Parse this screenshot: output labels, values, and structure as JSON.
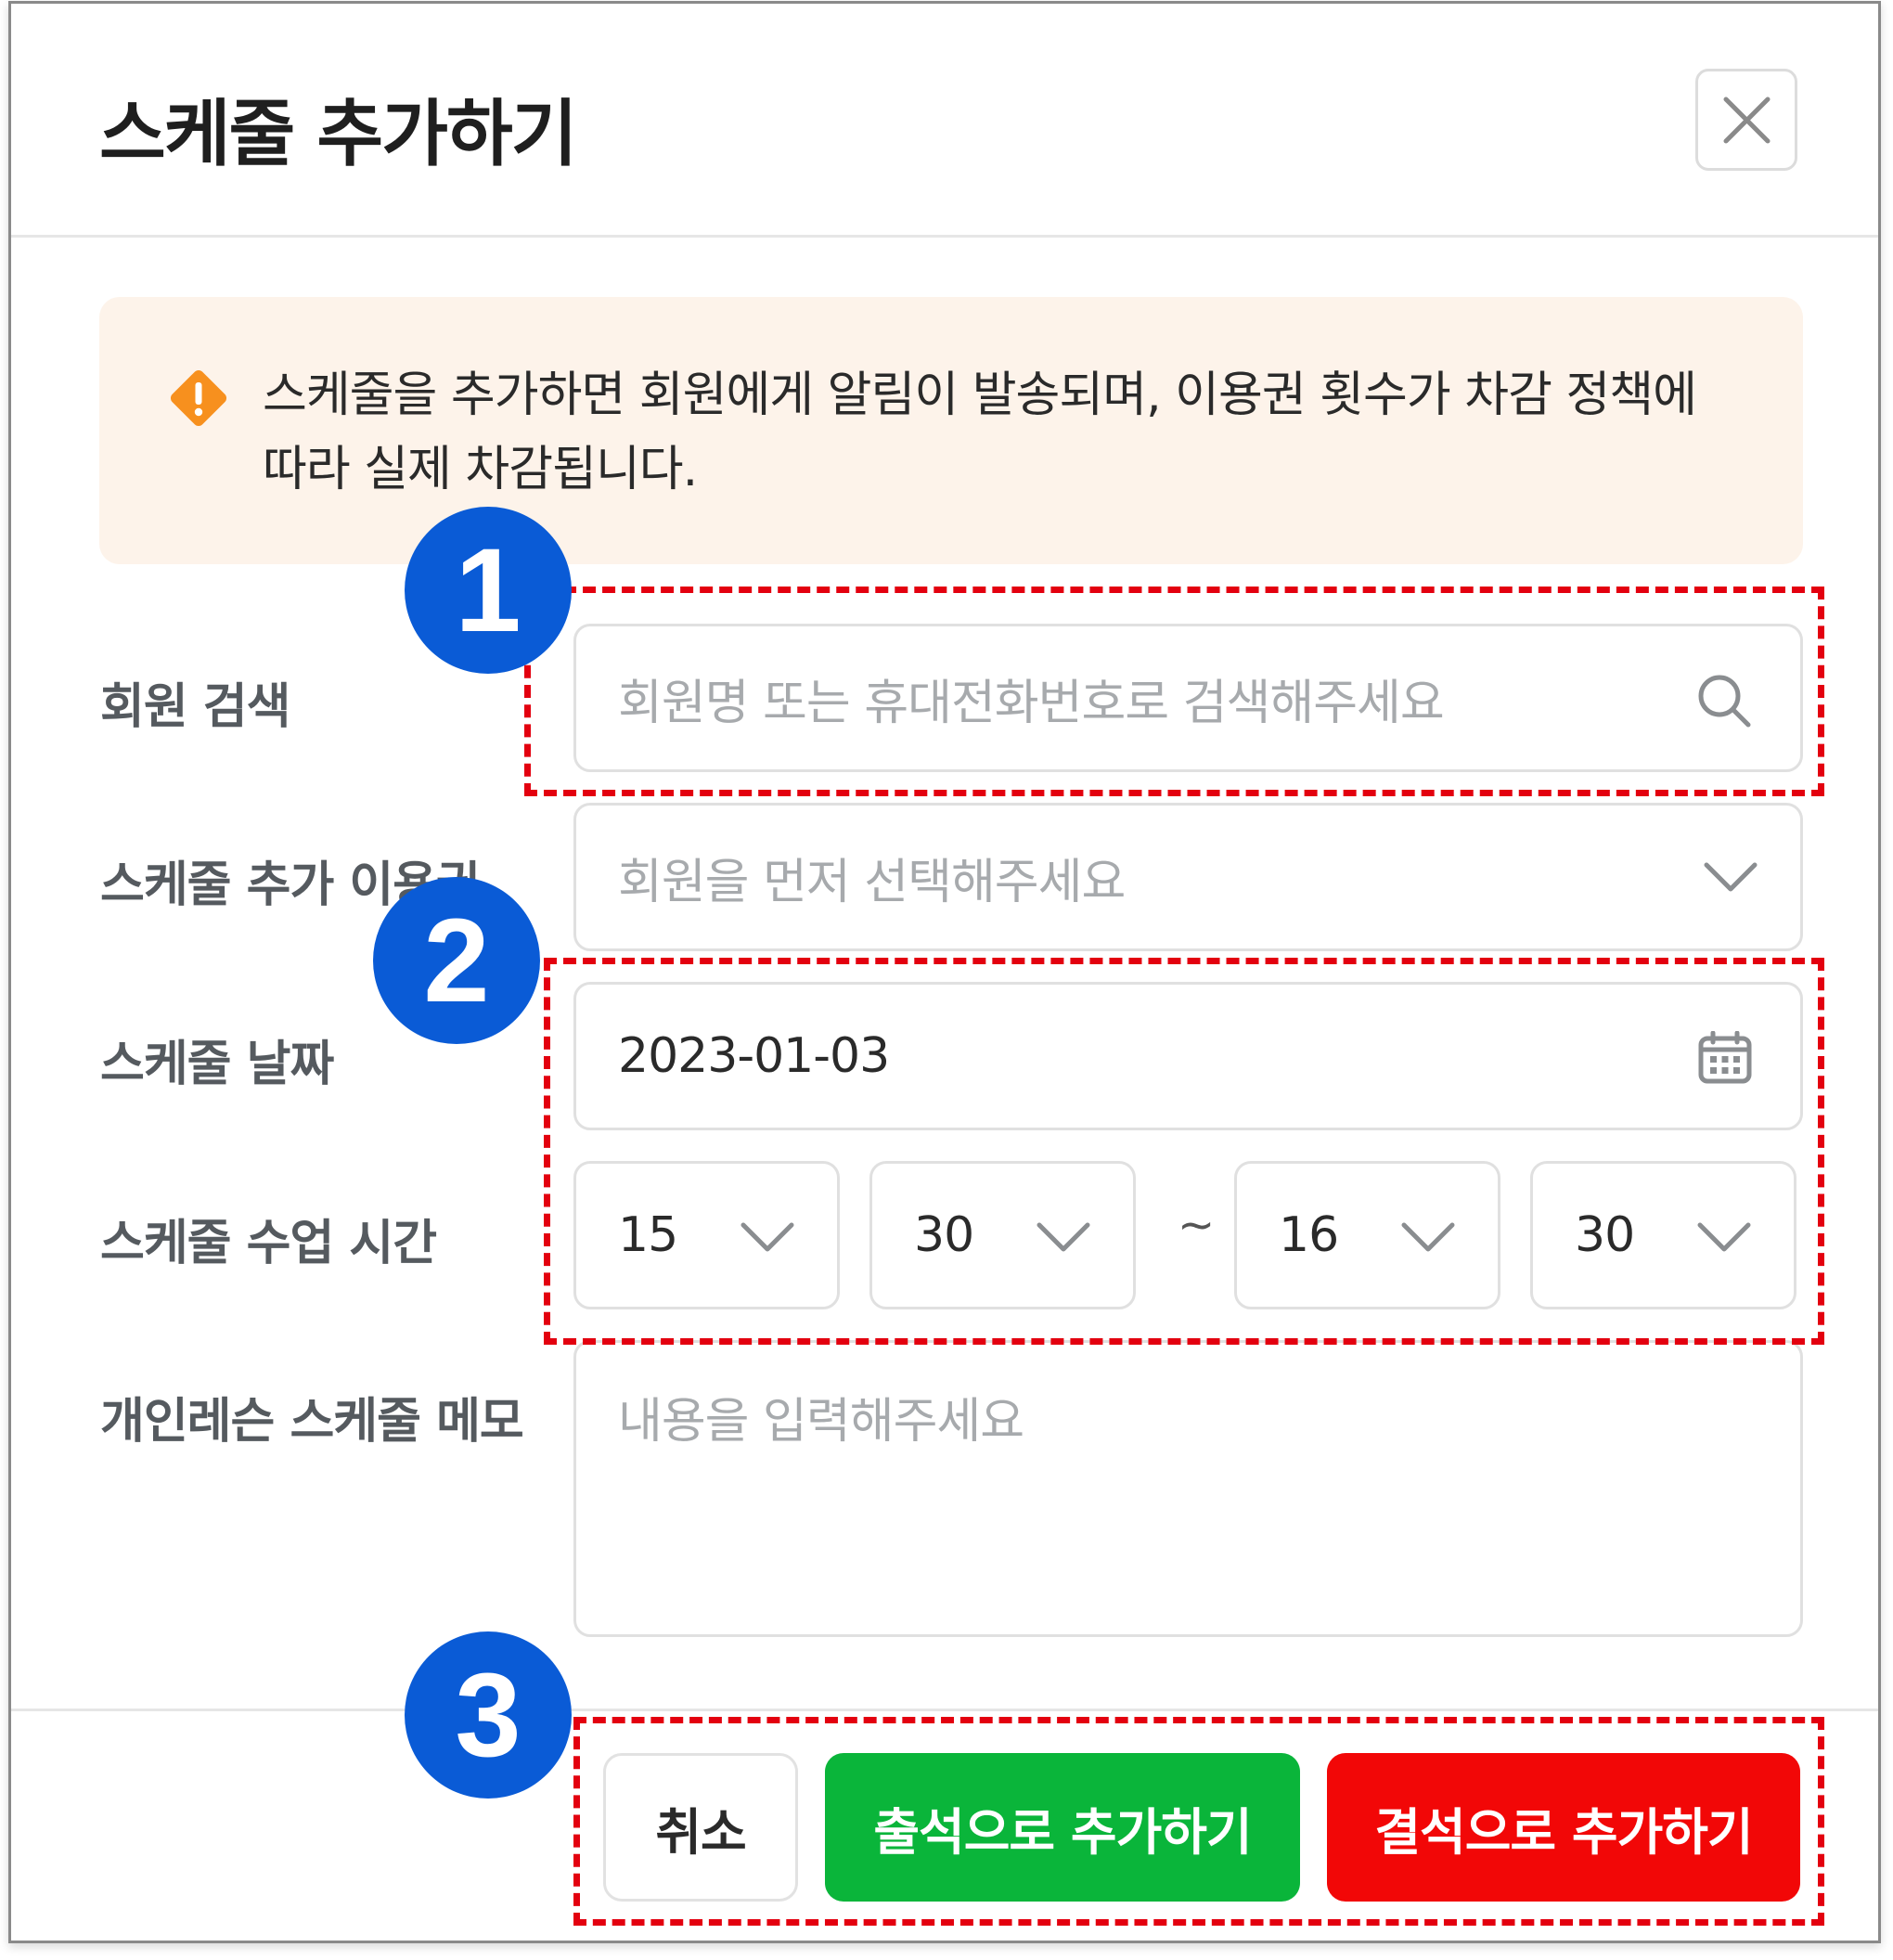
{
  "dialog": {
    "title": "스케줄 추가하기",
    "close_icon": "close-icon"
  },
  "notice": {
    "icon": "warning-diamond-icon",
    "color": "#f7901e",
    "line1": "스케줄을 추가하면 회원에게 알림이 발송되며, 이용권 횟수가 차감 정책에",
    "line2": "따라 실제 차감됩니다."
  },
  "form": {
    "member_search": {
      "label": "회원 검색",
      "placeholder": "회원명 또는 휴대전화번호로 검색해주세요",
      "icon": "search-icon"
    },
    "pass": {
      "label": "스케줄 추가 이용권",
      "placeholder": "회원을 먼저 선택해주세요",
      "icon": "chevron-down-icon"
    },
    "date": {
      "label": "스케줄 날짜",
      "value": "2023-01-03",
      "icon": "calendar-icon"
    },
    "time": {
      "label": "스케줄 수업 시간",
      "start_hour": "15",
      "start_minute": "30",
      "separator": "~",
      "end_hour": "16",
      "end_minute": "30"
    },
    "memo": {
      "label": "개인레슨 스케줄 메모",
      "placeholder": "내용을 입력해주세요"
    }
  },
  "footer": {
    "cancel_label": "취소",
    "attend_label": "출석으로 추가하기",
    "absent_label": "결석으로 추가하기",
    "attend_color": "#0ab53a",
    "absent_color": "#f20707"
  },
  "annotations": {
    "badge_1": "1",
    "badge_2": "2",
    "badge_3": "3",
    "badge_color": "#0a5bd6",
    "outline_color": "#e3000f"
  }
}
